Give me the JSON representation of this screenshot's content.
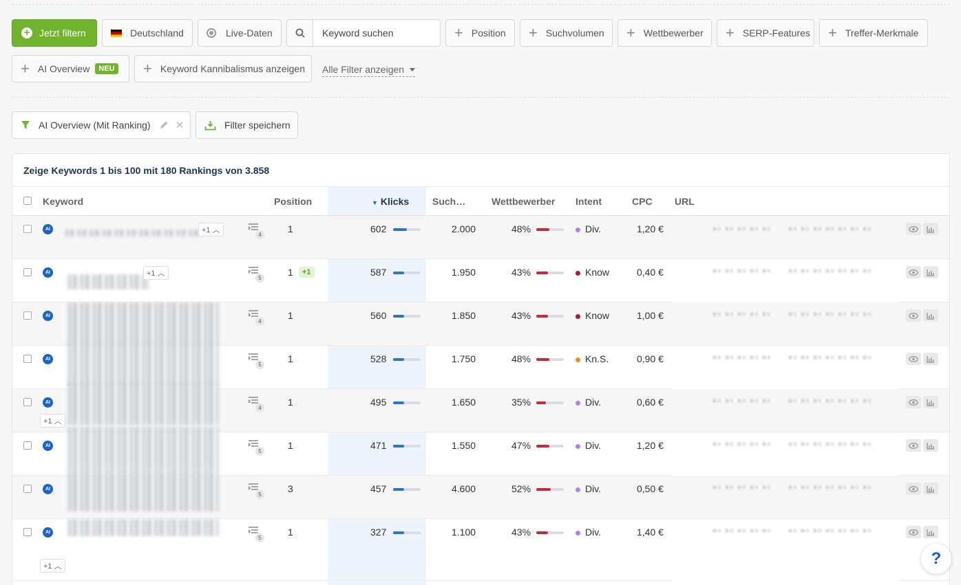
{
  "toolbar": {
    "apply_filter": "Jetzt filtern",
    "country": "Deutschland",
    "live": "Live-Daten",
    "search_placeholder": "Keyword suchen",
    "filters": [
      "Position",
      "Suchvolumen",
      "Wettbewerber",
      "SERP-Features",
      "Treffer-Merkmale"
    ],
    "ai_overview": "AI Overview",
    "neu_badge": "NEU",
    "cannibal": "Keyword Kannibalismus anzeigen",
    "all_filters": "Alle Filter anzeigen"
  },
  "active_filter": {
    "label": "AI Overview (Mit Ranking)",
    "save": "Filter speichern"
  },
  "table": {
    "summary": "Zeige Keywords 1 bis 100 mit 180 Rankings von 3.858",
    "headers": {
      "keyword": "Keyword",
      "position": "Position",
      "klicks": "Klicks",
      "such": "Such…",
      "wettbewerber": "Wettbewerber",
      "intent": "Intent",
      "cpc": "CPC",
      "url": "URL"
    },
    "rows": [
      {
        "serp": "4",
        "position": "1",
        "pos_change": "",
        "klicks": "602",
        "klicks_frac": 0.5,
        "such": "2.000",
        "wett": "48%",
        "wett_frac": 0.48,
        "intent": "Div.",
        "intent_color": "#b77fe0",
        "cpc": "1,20 €",
        "plus": "+1"
      },
      {
        "serp": "5",
        "position": "1",
        "pos_change": "+1",
        "klicks": "587",
        "klicks_frac": 0.4,
        "such": "1.950",
        "wett": "43%",
        "wett_frac": 0.43,
        "intent": "Know",
        "intent_color": "#b0173a",
        "cpc": "0,40 €",
        "plus": "+1"
      },
      {
        "serp": "4",
        "position": "1",
        "pos_change": "",
        "klicks": "560",
        "klicks_frac": 0.4,
        "such": "1.850",
        "wett": "43%",
        "wett_frac": 0.43,
        "intent": "Know",
        "intent_color": "#b0173a",
        "cpc": "1,00 €",
        "plus": ""
      },
      {
        "serp": "5",
        "position": "1",
        "pos_change": "",
        "klicks": "528",
        "klicks_frac": 0.4,
        "such": "1.750",
        "wett": "48%",
        "wett_frac": 0.48,
        "intent": "Kn.S.",
        "intent_color": "#f28c1e",
        "cpc": "0,90 €",
        "plus": ""
      },
      {
        "serp": "4",
        "position": "1",
        "pos_change": "",
        "klicks": "495",
        "klicks_frac": 0.4,
        "such": "1.650",
        "wett": "35%",
        "wett_frac": 0.35,
        "intent": "Div.",
        "intent_color": "#b77fe0",
        "cpc": "0,60 €",
        "plus": "+1"
      },
      {
        "serp": "5",
        "position": "1",
        "pos_change": "",
        "klicks": "471",
        "klicks_frac": 0.4,
        "such": "1.550",
        "wett": "47%",
        "wett_frac": 0.47,
        "intent": "Div.",
        "intent_color": "#b77fe0",
        "cpc": "1,20 €",
        "plus": ""
      },
      {
        "serp": "5",
        "position": "3",
        "pos_change": "",
        "klicks": "457",
        "klicks_frac": 0.4,
        "such": "4.600",
        "wett": "52%",
        "wett_frac": 0.52,
        "intent": "Div.",
        "intent_color": "#b77fe0",
        "cpc": "0,50 €",
        "plus": ""
      },
      {
        "serp": "5",
        "position": "1",
        "pos_change": "",
        "klicks": "327",
        "klicks_frac": 0.4,
        "such": "1.100",
        "wett": "43%",
        "wett_frac": 0.43,
        "intent": "Div.",
        "intent_color": "#b77fe0",
        "cpc": "1,40 €",
        "plus": "+1"
      }
    ]
  },
  "help": "?"
}
